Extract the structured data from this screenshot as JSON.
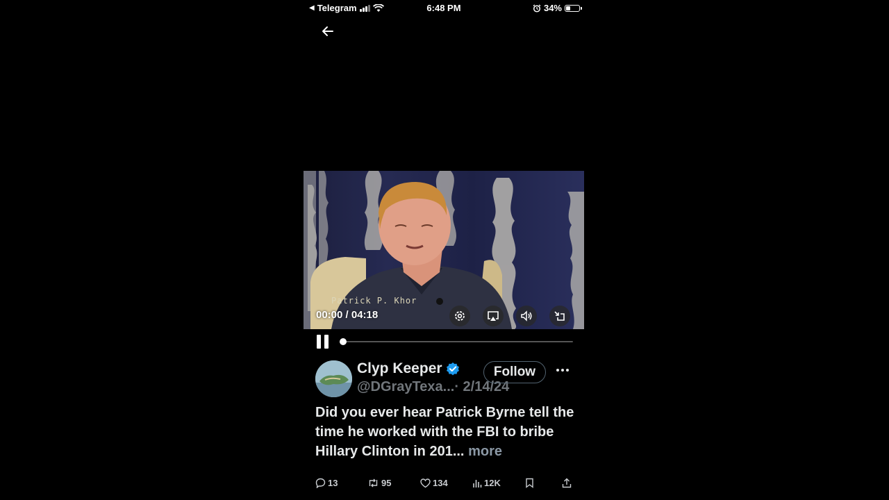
{
  "status_bar": {
    "back_app": "Telegram",
    "time": "6:48 PM",
    "battery": "34%",
    "battery_level": 0.34,
    "icons": [
      "back-triangle-icon",
      "signal-icon",
      "wifi-icon",
      "alarm-icon",
      "battery-icon"
    ]
  },
  "navigation": {
    "back_icon": "arrow-left-icon"
  },
  "video": {
    "time": "00:00 / 04:18",
    "burned_caption": "Patrick P. Khor",
    "controls": [
      "settings-icon",
      "airplay-icon",
      "volume-icon",
      "fullscreen-exit-icon"
    ],
    "progress": 0.0
  },
  "player": {
    "state_icon": "pause-icon"
  },
  "tweet": {
    "display_name": "Clyp Keeper",
    "verified": true,
    "handle": "@DGrayTexa...",
    "date": "· 2/14/24",
    "follow_label": "Follow",
    "text": "Did you ever hear Patrick Byrne tell the time he worked with the FBI to bribe Hillary Clinton in 201... ",
    "more_label": "more",
    "actions": {
      "replies": "13",
      "reposts": "95",
      "likes": "134",
      "views": "12K"
    }
  },
  "colors": {
    "background": "#000000",
    "text_primary": "#e7e9ea",
    "text_secondary": "#71767b",
    "verified_blue": "#1d9bf0"
  }
}
